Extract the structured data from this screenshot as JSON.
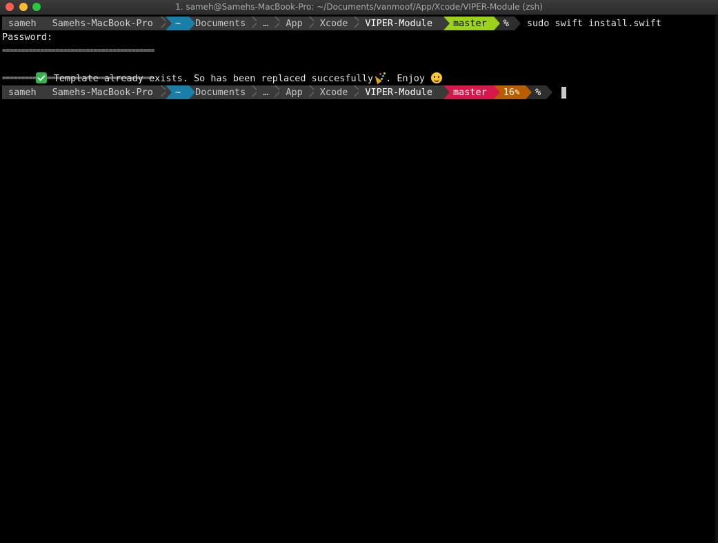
{
  "window": {
    "title": "1. sameh@Samehs-MacBook-Pro: ~/Documents/vanmoof/App/Xcode/VIPER-Module (zsh)"
  },
  "colors": {
    "close": "#fd5f57",
    "minimize": "#febc2e",
    "zoom": "#28c840",
    "home_segment": "#1a7fa7",
    "branch_clean": "#9cd21b",
    "branch_dirty": "#d6194a",
    "changes_segment": "#b85e00"
  },
  "prompt1": {
    "user": "sameh",
    "host": "Samehs-MacBook-Pro",
    "home": "~",
    "dirs": [
      "Documents",
      "…",
      "App",
      "Xcode",
      "VIPER-Module"
    ],
    "branch": "master",
    "symbol": "%",
    "command": "sudo swift install.swift"
  },
  "output": {
    "password_line": "Password:",
    "rule_top": "========================================",
    "message_text": "Template already exists. So has been replaced succesfully",
    "message_mid": ". Enjoy",
    "rule_bottom": "========================================",
    "check_icon": "check-mark-button-icon",
    "party_icon": "party-popper-icon",
    "smile_icon": "smiling-face-icon"
  },
  "prompt2": {
    "user": "sameh",
    "host": "Samehs-MacBook-Pro",
    "home": "~",
    "dirs": [
      "Documents",
      "…",
      "App",
      "Xcode",
      "VIPER-Module"
    ],
    "branch": "master",
    "changes": "16✎",
    "symbol": "%"
  }
}
